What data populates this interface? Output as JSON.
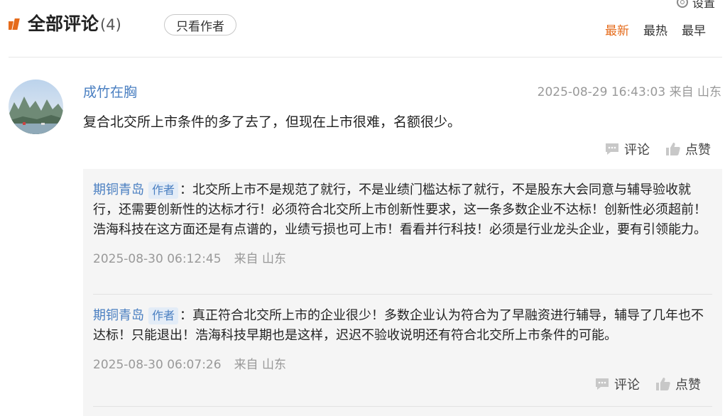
{
  "header": {
    "settings_label": "设置",
    "title": "全部评论",
    "count": "(4)",
    "author_only_label": "只看作者",
    "sort_tabs": [
      "最新",
      "最热",
      "最早"
    ],
    "accent_color": "#e56b1b",
    "link_color": "#4a7fc1"
  },
  "comment": {
    "username": "成竹在胸",
    "timestamp": "2025-08-29 16:43:03",
    "location": "来自 山东",
    "text": "复合北交所上市条件的多了去了，但现在上市很难，名额很少。",
    "comment_label": "评论",
    "like_label": "点赞"
  },
  "replies": [
    {
      "name": "期铜青岛",
      "tag": "作者",
      "text": "：北交所上市不是规范了就行，不是业绩门槛达标了就行，不是股东大会同意与辅导验收就行，还需要创新性的达标才行！必须符合北交所上市创新性要求，这一条多数企业不达标！创新性必须超前！浩海科技在这方面还是有点谱的，业绩亏损也可上市！看看并行科技！必须是行业龙头企业，要有引领能力。",
      "timestamp": "2025-08-30 06:12:45",
      "location": "来自 山东"
    },
    {
      "name": "期铜青岛",
      "tag": "作者",
      "text": "：真正符合北交所上市的企业很少！多数企业认为符合为了早融资进行辅导，辅导了几年也不达标！只能退出！浩海科技早期也是这样，迟迟不验收说明还有符合北交所上市条件的可能。",
      "timestamp": "2025-08-30 06:07:26",
      "location": "来自 山东",
      "comment_label": "评论",
      "like_label": "点赞"
    }
  ]
}
